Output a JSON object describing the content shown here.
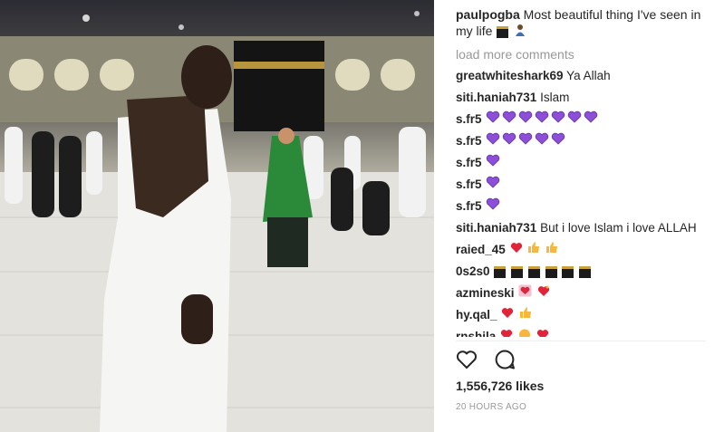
{
  "post": {
    "caption_user": "paulpogba",
    "caption_text": "Most beautiful thing I've seen in my life",
    "load_more": "load more comments",
    "likes": "1,556,726 likes",
    "time": "20 HOURS AGO"
  },
  "comments": [
    {
      "user": "greatwhiteshark69",
      "text": "Ya Allah"
    },
    {
      "user": "siti.haniah731",
      "text": "Islam"
    },
    {
      "user": "s.fr5",
      "text": "",
      "emoji": "purple-heart-icon x7"
    },
    {
      "user": "s.fr5",
      "text": "",
      "emoji": "purple-heart-icon x5"
    },
    {
      "user": "s.fr5",
      "text": "",
      "emoji": "purple-heart-icon x1"
    },
    {
      "user": "s.fr5",
      "text": "",
      "emoji": "purple-heart-icon x1"
    },
    {
      "user": "s.fr5",
      "text": "",
      "emoji": "purple-heart-icon x1"
    },
    {
      "user": "siti.haniah731",
      "text": "But i love Islam i love ALLAH"
    },
    {
      "user": "raied_45",
      "text": "",
      "emoji": "red-heart thumbs-up thumbs-up"
    },
    {
      "user": "0s2s0",
      "text": "",
      "emoji": "kaaba-icon x6"
    },
    {
      "user": "azmineski",
      "text": "",
      "emoji": "heart-icons"
    },
    {
      "user": "hy.qal_",
      "text": "",
      "emoji": "red-heart thumbs-up"
    },
    {
      "user": "rnshila",
      "text": "",
      "emoji": "hearts"
    }
  ],
  "colors": {
    "purple": "#8d4ed8",
    "red": "#e0243a",
    "yellow": "#f6b73c",
    "muted": "#999999"
  }
}
